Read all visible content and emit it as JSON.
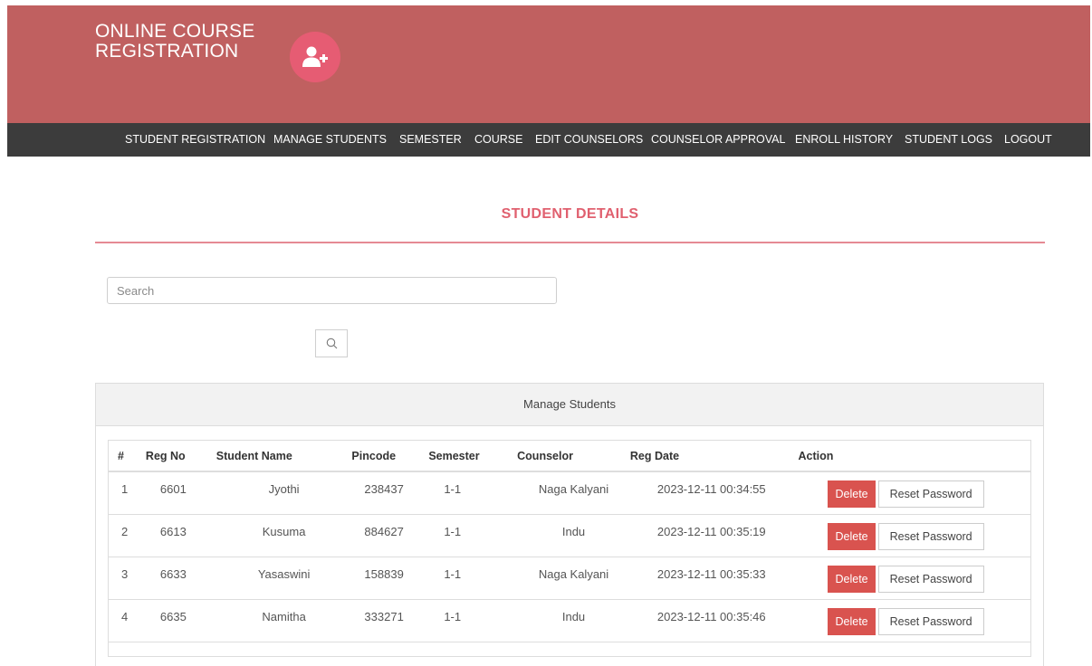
{
  "brand": {
    "line1": "ONLINE COURSE",
    "line2": "REGISTRATION",
    "icon": "add-user-icon"
  },
  "nav": [
    "STUDENT REGISTRATION",
    "MANAGE STUDENTS",
    "SEMESTER",
    "COURSE",
    "EDIT COUNSELORS",
    "COUNSELOR APPROVAL",
    "ENROLL HISTORY",
    "STUDENT LOGS",
    "LOGOUT"
  ],
  "page": {
    "title": "STUDENT DETAILS"
  },
  "search": {
    "placeholder": "Search",
    "value": "",
    "button_icon": "search-icon"
  },
  "panel": {
    "heading": "Manage Students",
    "columns": [
      "#",
      "Reg No",
      "Student Name",
      "Pincode",
      "Semester",
      "Counselor",
      "Reg Date",
      "Action"
    ],
    "rows": [
      {
        "num": "1",
        "reg_no": "6601",
        "name": "Jyothi",
        "pincode": "238437",
        "semester": "1-1",
        "counselor": "Naga Kalyani",
        "reg_date": "2023-12-11 00:34:55",
        "delete": "Delete",
        "reset": "Reset Password"
      },
      {
        "num": "2",
        "reg_no": "6613",
        "name": "Kusuma",
        "pincode": "884627",
        "semester": "1-1",
        "counselor": "Indu",
        "reg_date": "2023-12-11 00:35:19",
        "delete": "Delete",
        "reset": "Reset Password"
      },
      {
        "num": "3",
        "reg_no": "6633",
        "name": "Yasaswini",
        "pincode": "158839",
        "semester": "1-1",
        "counselor": "Naga Kalyani",
        "reg_date": "2023-12-11 00:35:33",
        "delete": "Delete",
        "reset": "Reset Password"
      },
      {
        "num": "4",
        "reg_no": "6635",
        "name": "Namitha",
        "pincode": "333271",
        "semester": "1-1",
        "counselor": "Indu",
        "reg_date": "2023-12-11 00:35:46",
        "delete": "Delete",
        "reset": "Reset Password"
      }
    ]
  },
  "colors": {
    "header": "#c06060",
    "nav": "#3c3c3c",
    "accent": "#e0606f",
    "delete": "#d9534f",
    "icon_circle": "#e65c73"
  }
}
